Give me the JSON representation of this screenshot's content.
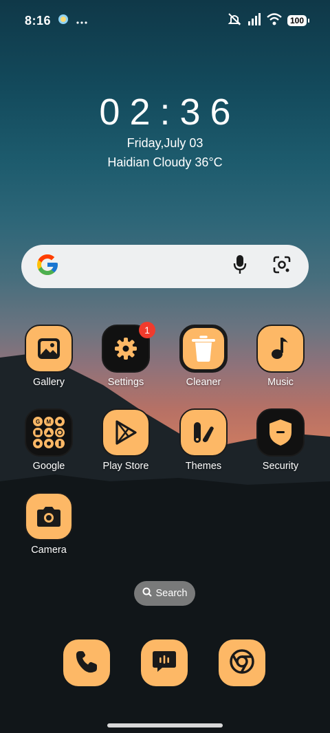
{
  "status_bar": {
    "time": "8:16",
    "battery": "100",
    "icons": [
      "app-notification-icon",
      "more-dots-icon",
      "mute-icon",
      "signal-icon",
      "wifi-icon",
      "battery-icon"
    ]
  },
  "lock_widget": {
    "clock": "02:36",
    "date": "Friday,July 03",
    "weather": "Haidian Cloudy 36°C"
  },
  "search_bar": {
    "icons": [
      "google-logo-icon",
      "microphone-icon",
      "lens-icon"
    ]
  },
  "apps": [
    {
      "label": "Gallery",
      "icon": "gallery-icon"
    },
    {
      "label": "Settings",
      "icon": "gear-icon",
      "badge": "1"
    },
    {
      "label": "Cleaner",
      "icon": "trash-icon"
    },
    {
      "label": "Music",
      "icon": "music-note-icon"
    },
    {
      "label": "Google",
      "icon": "google-folder-icon"
    },
    {
      "label": "Play Store",
      "icon": "play-store-icon"
    },
    {
      "label": "Themes",
      "icon": "themes-icon"
    },
    {
      "label": "Security",
      "icon": "shield-icon"
    },
    {
      "label": "Camera",
      "icon": "camera-icon"
    }
  ],
  "search_pill": {
    "label": "Search"
  },
  "dock": [
    {
      "icon": "phone-icon"
    },
    {
      "icon": "messages-icon"
    },
    {
      "icon": "chrome-icon"
    }
  ],
  "colors": {
    "icon_bg": "#fdb866",
    "badge": "#f03b2d"
  }
}
